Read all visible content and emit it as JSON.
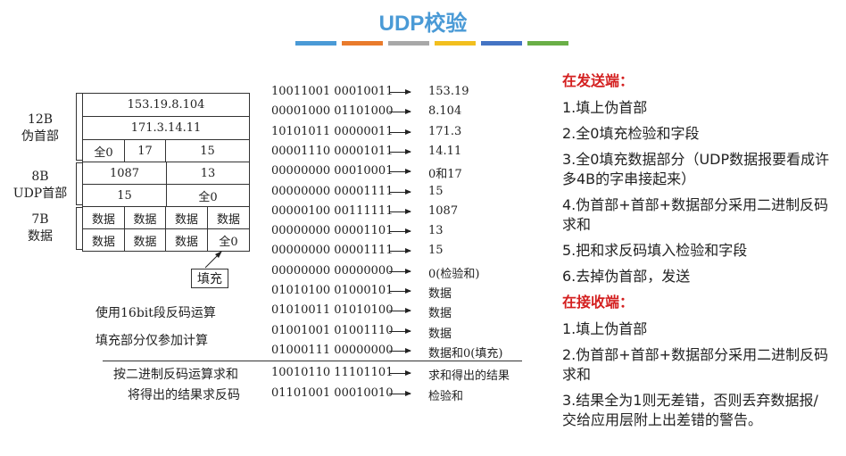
{
  "title": "UDP校验",
  "color_bar": [
    "#4a9ad6",
    "#e97b2c",
    "#a8a8a8",
    "#f2bf1e",
    "#4474c4",
    "#6aaf47"
  ],
  "left_labels": {
    "pseudo": "12B\n伪首部",
    "udp": "8B\nUDP首部",
    "data": "7B\n数据"
  },
  "table": {
    "src_ip": "153.19.8.104",
    "dst_ip": "171.3.14.11",
    "zero": "全0",
    "protocol": "17",
    "length": "15",
    "src_port": "1087",
    "dst_port": "13",
    "udp_length": "15",
    "checksum": "全0",
    "data_cells": [
      "数据",
      "数据",
      "数据",
      "数据",
      "数据",
      "数据",
      "数据",
      "全0"
    ],
    "fill_label": "填充"
  },
  "rows": [
    {
      "bin": "10011001 00010011",
      "res": "153.19"
    },
    {
      "bin": "00001000 01101000",
      "res": "8.104"
    },
    {
      "bin": "10101011 00000011",
      "res": "171.3"
    },
    {
      "bin": "00001110 00001011",
      "res": "14.11"
    },
    {
      "bin": "00000000 00010001",
      "res": "0和17"
    },
    {
      "bin": "00000000 00001111",
      "res": "15"
    },
    {
      "bin": "00000100 00111111",
      "res": "1087"
    },
    {
      "bin": "00000000 00001101",
      "res": "13"
    },
    {
      "bin": "00000000 00001111",
      "res": "15"
    },
    {
      "bin": "00000000 00000000",
      "res": "0(检验和)"
    },
    {
      "bin": "01010100 01000101",
      "res": "数据"
    },
    {
      "bin": "01010011 01010100",
      "res": "数据"
    },
    {
      "bin": "01001001 01001110",
      "res": "数据"
    },
    {
      "bin": "01000111 00000000",
      "res": "数据和0(填充)"
    }
  ],
  "sum_row": {
    "bin": "10010110 11101101",
    "res": "求和得出的结果"
  },
  "check_row": {
    "bin": "01101001 00010010",
    "res": "检验和"
  },
  "notes": {
    "n1": "使用16bit段反码运算",
    "n2": "填充部分仅参加计算",
    "n3": "按二进制反码运算求和",
    "n4": "将得出的结果求反码"
  },
  "sender": {
    "heading": "在发送端：",
    "items": [
      "1.填上伪首部",
      "2.全0填充检验和字段",
      "3.全0填充数据部分（UDP数据报要看成许多4B的字串接起来）",
      "4.伪首部+首部+数据部分采用二进制反码求和",
      "5.把和求反码填入检验和字段",
      "6.去掉伪首部，发送"
    ]
  },
  "receiver": {
    "heading": "在接收端：",
    "items": [
      "1.填上伪首部",
      "2.伪首部+首部+数据部分采用二进制反码求和",
      "3.结果全为1则无差错，否则丢弃数据报/交给应用层附上出差错的警告。"
    ]
  }
}
